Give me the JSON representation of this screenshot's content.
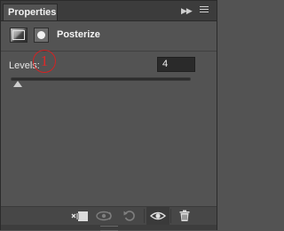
{
  "tabs": [
    {
      "label": "Properties"
    }
  ],
  "header": {
    "title": "Posterize",
    "adjustment_icon": "adjustment-layer-icon",
    "mask_icon": "layer-mask-icon"
  },
  "levels": {
    "label": "Levels:",
    "value": "4"
  },
  "slider": {
    "value": 4,
    "min": 2,
    "max": 255
  },
  "annotation": {
    "text": "1"
  },
  "colors": {
    "panel": "#535353",
    "tabbar": "#3c3c3c",
    "input": "#2a2a2a",
    "annotation": "#d12323"
  },
  "toolbar": {
    "items": [
      {
        "icon": "clip-to-layer-icon"
      },
      {
        "icon": "view-previous-state-icon"
      },
      {
        "icon": "reset-icon"
      },
      {
        "icon": "eye-visibility-icon"
      },
      {
        "icon": "trash-icon"
      }
    ]
  }
}
